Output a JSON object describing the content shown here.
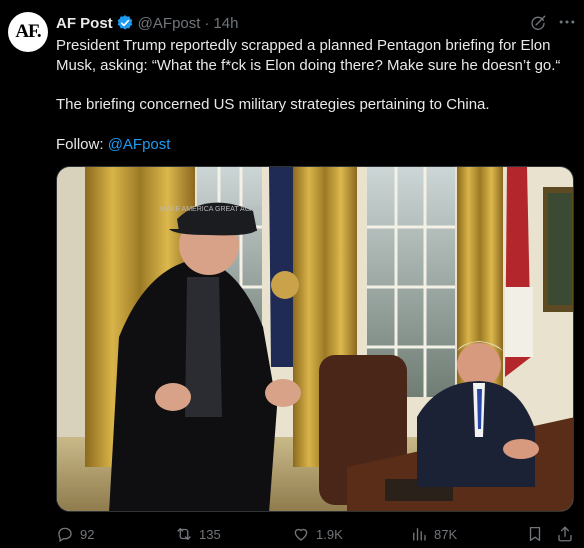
{
  "post": {
    "avatar_text": "AF.",
    "author_name": "AF Post",
    "handle": "@AFpost",
    "separator": "·",
    "time": "14h",
    "paragraph_1": "President Trump reportedly scrapped a planned Pentagon briefing for Elon Musk, asking: “What the f*ck is Elon doing there? Make sure he doesn’t go.“",
    "paragraph_2": "The briefing concerned US military strategies pertaining to China.",
    "follow_label": "Follow: ",
    "follow_mention": "@AFpost",
    "hat_text": "MAKE AMERICA GREAT AGAIN"
  },
  "actions": {
    "replies": "92",
    "reposts": "135",
    "likes": "1.9K",
    "views": "87K"
  },
  "icons": [
    "verified-badge-icon",
    "grok-icon",
    "more-icon",
    "reply-icon",
    "repost-icon",
    "like-icon",
    "views-icon",
    "bookmark-icon",
    "share-icon"
  ],
  "colors": {
    "accent": "#1d9bf0",
    "muted": "#71767b",
    "text": "#e7e9ea",
    "background": "#000000"
  }
}
